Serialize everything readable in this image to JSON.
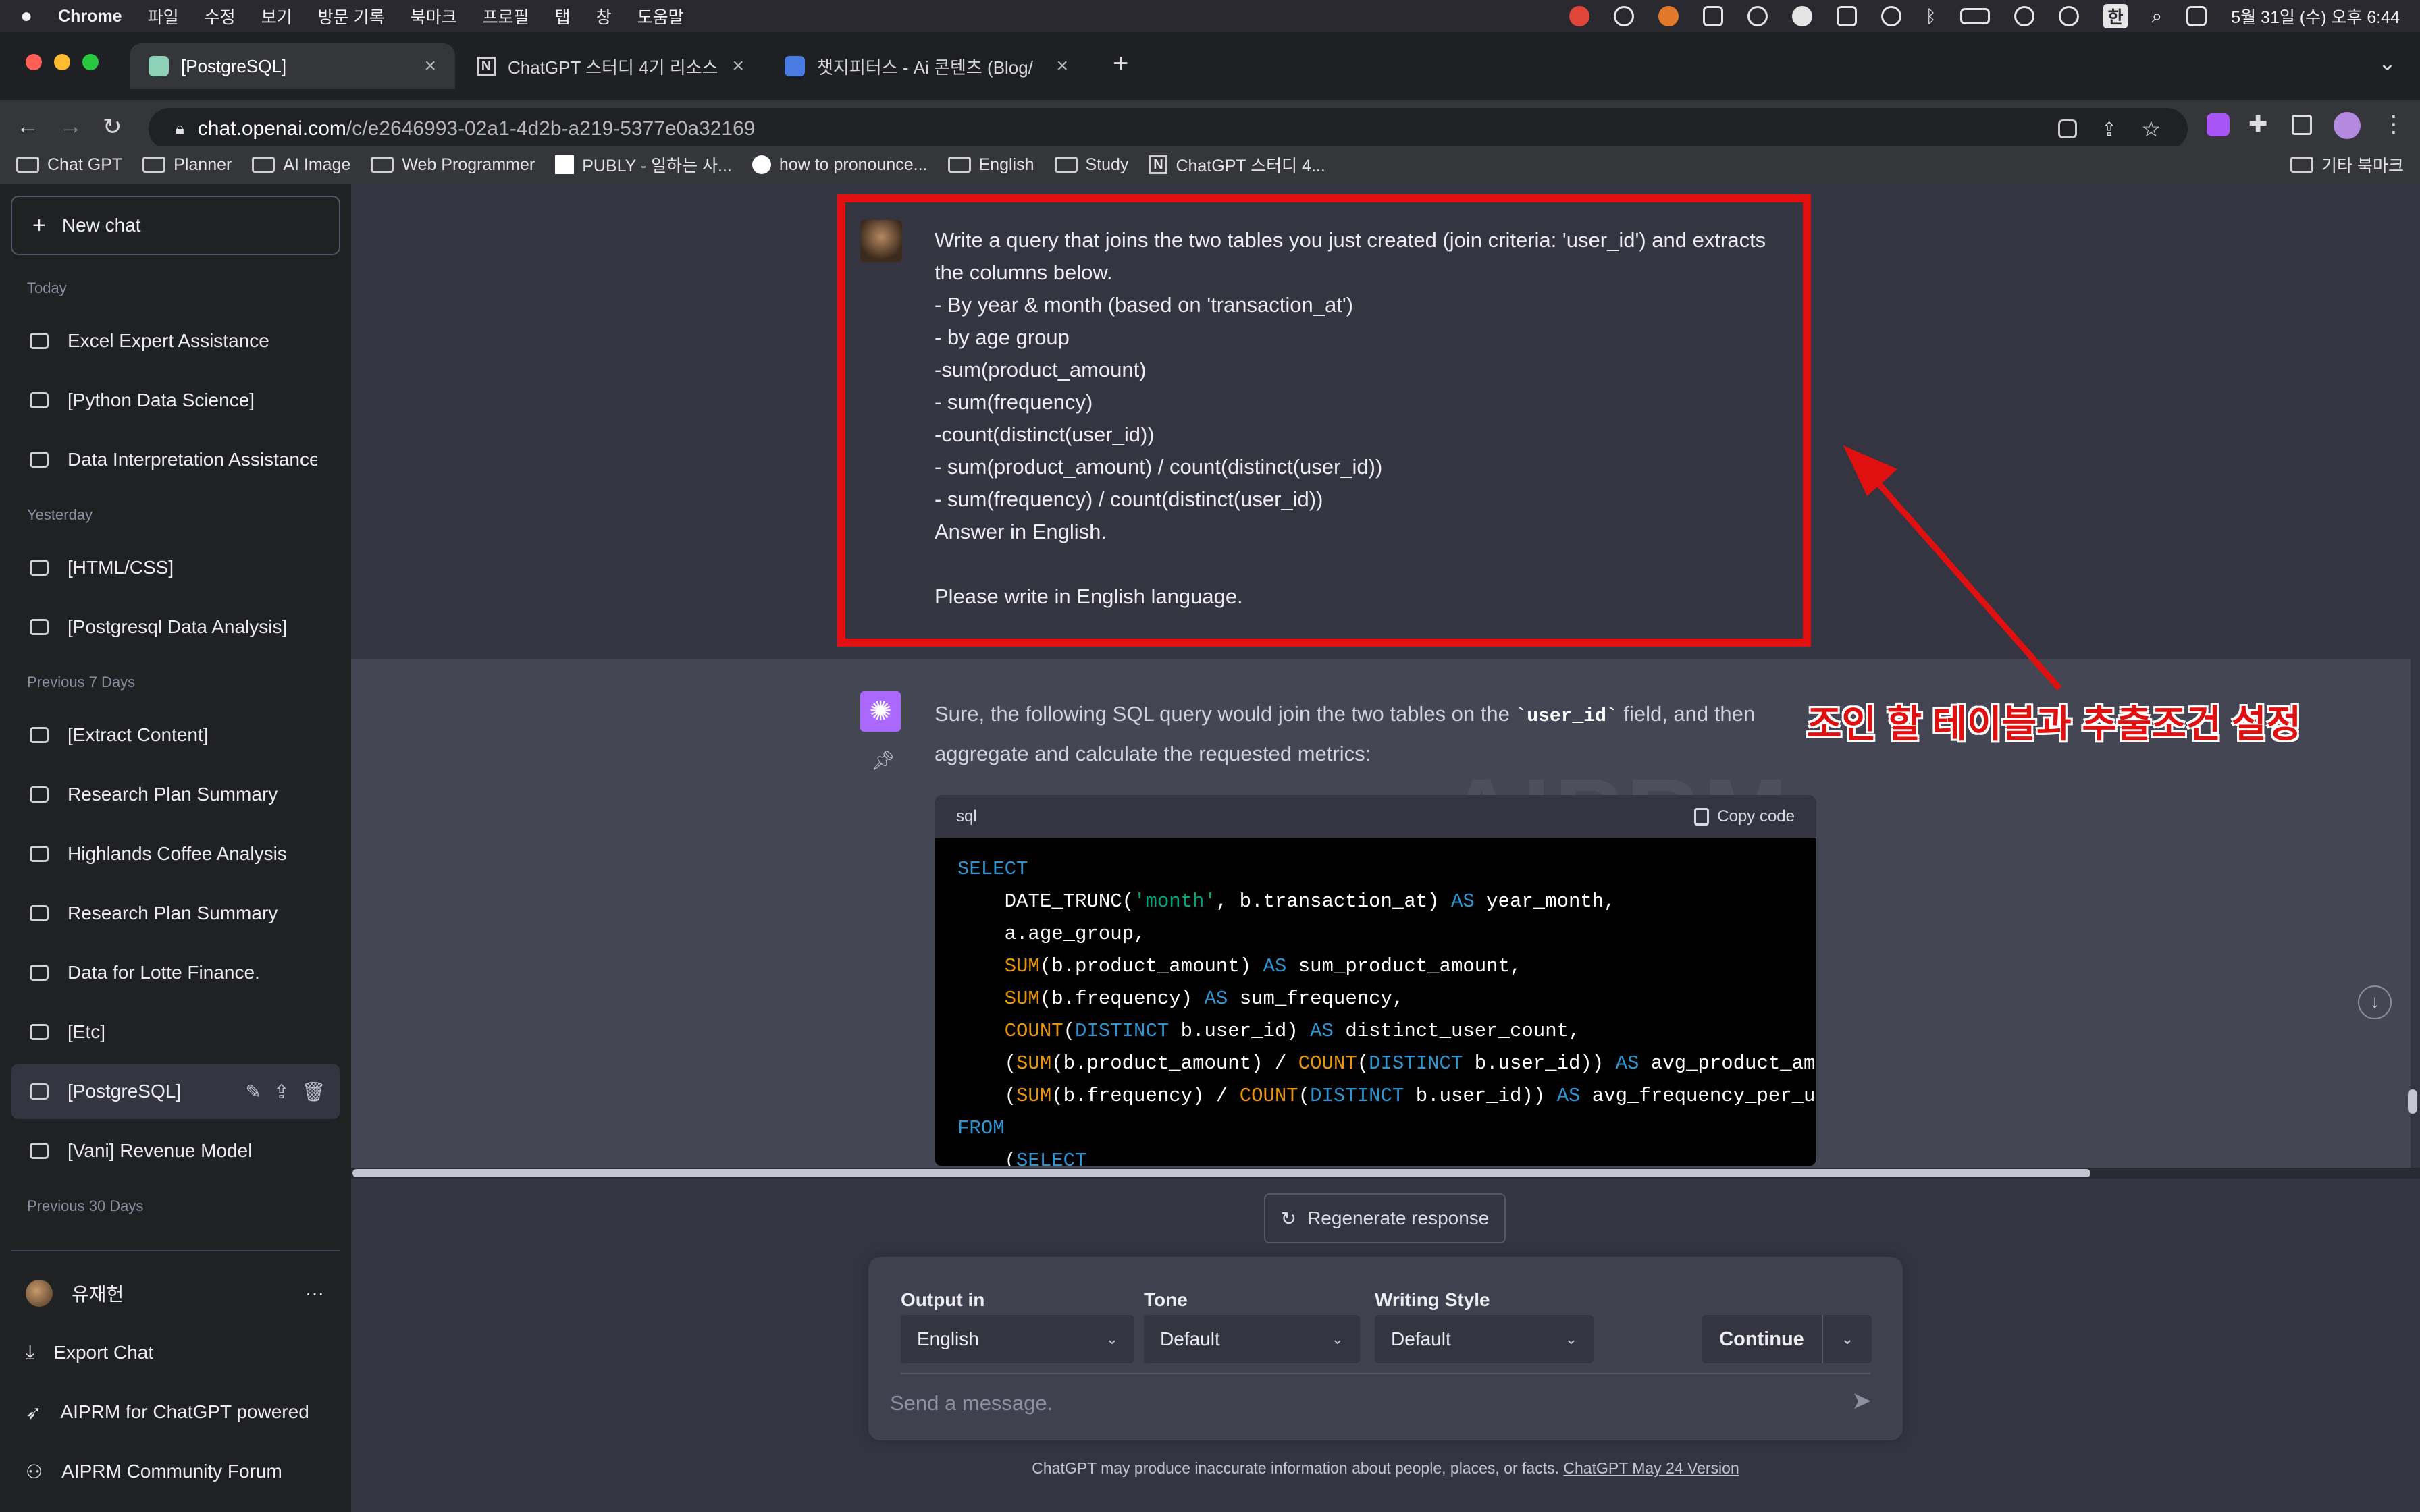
{
  "menubar": {
    "apple": "",
    "app": "Chrome",
    "menus": [
      "파일",
      "수정",
      "보기",
      "방문 기록",
      "북마크",
      "프로필",
      "탭",
      "창",
      "도움말"
    ],
    "ime": "한",
    "clock": "5월 31일 (수) 오후 6:44"
  },
  "tabs": [
    {
      "title": "[PostgreSQL]",
      "active": true
    },
    {
      "title": "ChatGPT 스터디 4기 리소스",
      "active": false
    },
    {
      "title": "챗지피터스 - Ai 콘텐츠 (Blog/유튜브",
      "active": false
    }
  ],
  "new_tab": "+",
  "tab_overflow": "⌄",
  "url": {
    "host": "chat.openai.com",
    "path": "/c/e2646993-02a1-4d2b-a219-5377e0a32169"
  },
  "bookmarks": [
    "Chat GPT",
    "Planner",
    "AI Image",
    "Web Programmer",
    "PUBLY - 일하는 사...",
    "how to pronounce...",
    "English",
    "Study",
    "ChatGPT 스터디 4..."
  ],
  "other_bookmarks": "기타 북마크",
  "sidebar": {
    "new_chat": "New chat",
    "sections": [
      {
        "label": "Today",
        "items": [
          "Excel Expert Assistance",
          "[Python Data Science]",
          "Data Interpretation Assistance"
        ]
      },
      {
        "label": "Yesterday",
        "items": [
          "[HTML/CSS]",
          "[Postgresql Data Analysis]"
        ]
      },
      {
        "label": "Previous 7 Days",
        "items": [
          "[Extract Content]",
          "Research Plan Summary",
          "Highlands Coffee Analysis",
          "Research Plan Summary",
          "Data for Lotte Finance.",
          "[Etc]",
          "[PostgreSQL]",
          "[Vani] Revenue Model"
        ]
      },
      {
        "label": "Previous 30 Days",
        "items": []
      }
    ],
    "user": "유재헌",
    "user_menu": "···",
    "footer": [
      "Export Chat",
      "AIPRM for ChatGPT powered",
      "AIPRM Community Forum"
    ]
  },
  "user_message": [
    "Write a query that joins the two tables you just created (join criteria: 'user_id') and extracts the columns below.",
    "- By year & month (based on 'transaction_at')",
    "- by age group",
    "-sum(product_amount)",
    "- sum(frequency)",
    "-count(distinct(user_id))",
    "- sum(product_amount) / count(distinct(user_id))",
    "- sum(frequency) / count(distinct(user_id))",
    "Answer in English.",
    "",
    "Please write in English language."
  ],
  "assistant": {
    "intro_before": "Sure, the following SQL query would join the two tables on the ",
    "intro_code": "`user_id`",
    "intro_after": " field, and then aggregate and calculate the requested metrics:",
    "code_lang": "sql",
    "copy_label": "Copy code",
    "watermark": "AIPRM",
    "code_lines": [
      "SELECT",
      "    DATE_TRUNC('month', b.transaction_at) AS year_month,",
      "    a.age_group,",
      "    SUM(b.product_amount) AS sum_product_amount,",
      "    SUM(b.frequency) AS sum_frequency,",
      "    COUNT(DISTINCT b.user_id) AS distinct_user_count,",
      "    (SUM(b.product_amount) / COUNT(DISTINCT b.user_id)) AS avg_product_amoun",
      "    (SUM(b.frequency) / COUNT(DISTINCT b.user_id)) AS avg_frequency_per_user",
      "FROM",
      "    (SELECT"
    ]
  },
  "annotation": "조인 할 테이블과 추출조건 설정",
  "composer": {
    "regenerate": "Regenerate response",
    "output_label": "Output in",
    "output_value": "English",
    "tone_label": "Tone",
    "tone_value": "Default",
    "style_label": "Writing Style",
    "style_value": "Default",
    "continue": "Continue",
    "placeholder": "Send a message.",
    "disclaimer": "ChatGPT may produce inaccurate information about people, places, or facts. ",
    "version_link": "ChatGPT May 24 Version"
  },
  "colors": {
    "highlight": "#e01010",
    "sidebar": "#202123",
    "chat_bg": "#343541",
    "assistant_bg": "#444654",
    "gpt_logo": "#ab68ff"
  }
}
